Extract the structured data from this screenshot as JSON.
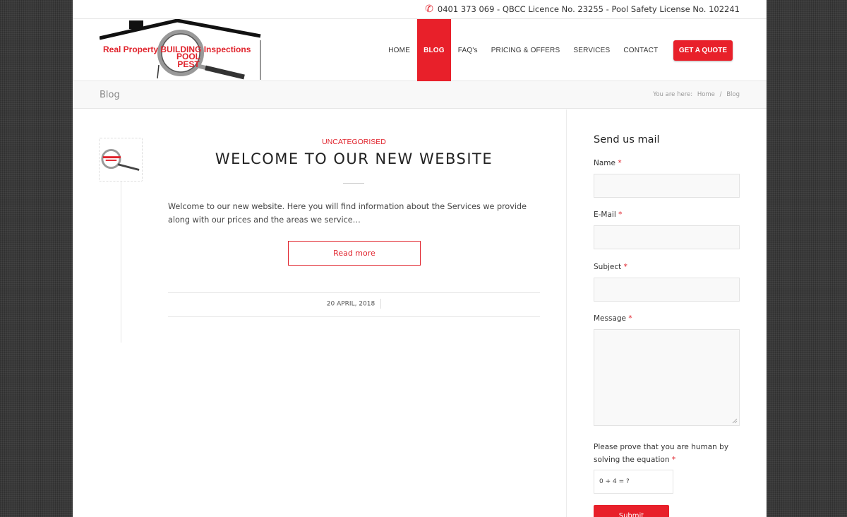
{
  "topbar": {
    "info": "0401 373 069 - QBCC Licence No. 23255 - Pool Safety License No. 102241"
  },
  "logo": {
    "line1": "Real Property BUILDING Inspections",
    "line2": "POOL",
    "line3": "PEST"
  },
  "nav": {
    "items": [
      {
        "label": "HOME"
      },
      {
        "label": "BLOG"
      },
      {
        "label": "FAQ's"
      },
      {
        "label": "PRICING & OFFERS"
      },
      {
        "label": "SERVICES"
      },
      {
        "label": "CONTACT"
      }
    ],
    "cta": "GET A QUOTE"
  },
  "titlebar": {
    "title": "Blog",
    "breadcrumb_prefix": "You are here:",
    "breadcrumb_home": "Home",
    "breadcrumb_sep": "/",
    "breadcrumb_current": "Blog"
  },
  "post": {
    "category": "UNCATEGORISED",
    "title": "WELCOME TO OUR NEW WEBSITE",
    "excerpt": "Welcome to our new website. Here you will find information about the Services we provide along with our prices and the areas we service…",
    "read_more": "Read more",
    "date": "20 APRIL, 2018"
  },
  "form": {
    "title": "Send us mail",
    "name_label": "Name",
    "email_label": "E-Mail",
    "subject_label": "Subject",
    "message_label": "Message",
    "required_mark": "*",
    "captcha_label": "Please prove that you are human by solving the equation",
    "captcha_equation": "0 + 4 = ?",
    "submit_label": "Submit"
  },
  "colors": {
    "accent": "#e8202a",
    "background": "#3a3a3a"
  }
}
